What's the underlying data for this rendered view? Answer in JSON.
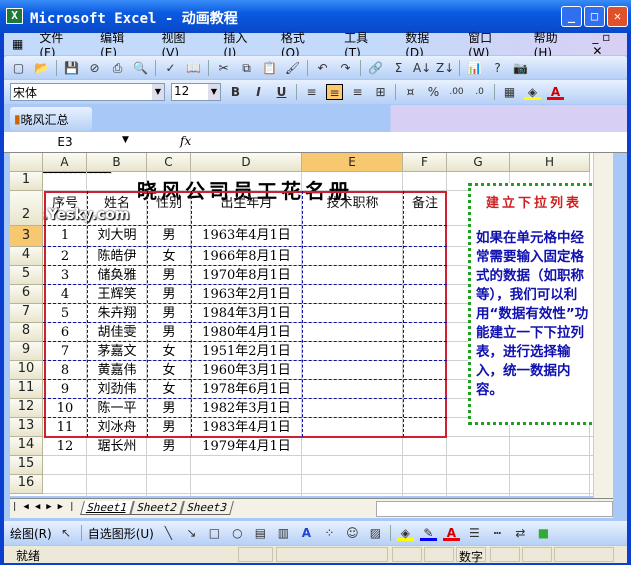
{
  "window": {
    "title": "Microsoft Excel - 动画教程",
    "minimize": "_",
    "maximize": "□",
    "close": "✕"
  },
  "menu": [
    "文件(F)",
    "编辑(E)",
    "视图(V)",
    "插入(I)",
    "格式(O)",
    "工具(T)",
    "数据(D)",
    "窗口(W)",
    "帮助(H)"
  ],
  "std_toolbar": [
    "new-icon",
    "open-icon",
    "save-icon",
    "permission-icon",
    "print-icon",
    "print-preview-icon",
    "spelling-icon",
    "research-icon",
    "cut-icon",
    "copy-icon",
    "paste-icon",
    "format-painter-icon",
    "undo-icon",
    "redo-icon",
    "hyperlink-icon",
    "autosum-icon",
    "sort-asc-icon",
    "sort-desc-icon",
    "chart-wizard-icon",
    "help-icon",
    "camera-icon"
  ],
  "fmt": {
    "font": "宋体",
    "size": "12",
    "bold": "B",
    "italic": "I",
    "underline": "U",
    "percent": "%"
  },
  "custom_toolbar": {
    "label": "晓风汇总"
  },
  "formula": {
    "name_box": "E3",
    "fx": "fx",
    "value": ""
  },
  "columns": [
    "A",
    "B",
    "C",
    "D",
    "E",
    "F",
    "G",
    "H"
  ],
  "rows": [
    "1",
    "2",
    "3",
    "4",
    "5",
    "6",
    "7",
    "8",
    "9",
    "10",
    "11",
    "12",
    "13",
    "14",
    "15",
    "16"
  ],
  "selected": {
    "column": "E",
    "row": "3"
  },
  "sheet_title": "晓风公司员工花名册",
  "headers": [
    "序号",
    "姓名",
    "性别",
    "出生年月",
    "技术职称",
    "备注"
  ],
  "records": [
    [
      "1",
      "刘大明",
      "男",
      "1963年4月1日"
    ],
    [
      "2",
      "陈皓伊",
      "女",
      "1966年8月1日"
    ],
    [
      "3",
      "储奂雅",
      "男",
      "1970年8月1日"
    ],
    [
      "4",
      "王辉笑",
      "男",
      "1963年2月1日"
    ],
    [
      "5",
      "朱卉翔",
      "男",
      "1984年3月1日"
    ],
    [
      "6",
      "胡佳雯",
      "男",
      "1980年4月1日"
    ],
    [
      "7",
      "茅嘉文",
      "女",
      "1951年2月1日"
    ],
    [
      "8",
      "黄嘉伟",
      "女",
      "1960年3月1日"
    ],
    [
      "9",
      "刘劲伟",
      "女",
      "1978年6月1日"
    ],
    [
      "10",
      "陈一平",
      "男",
      "1982年3月1日"
    ],
    [
      "11",
      "刘冰舟",
      "男",
      "1983年4月1日"
    ],
    [
      "12",
      "琚长州",
      "男",
      "1979年4月1日"
    ]
  ],
  "note": {
    "title": "建立下拉列表",
    "body": "如果在单元格中经常需要输入固定格式的数据（如职称等），我们可以利用“数据有效性”功能建立一下下拉列表，进行选择输入，统一数据内容。"
  },
  "watermark": "Soft.Yesky.com",
  "sheet_tabs": [
    "Sheet1",
    "Sheet2",
    "Sheet3"
  ],
  "draw_toolbar": {
    "draw": "绘图(R)",
    "autoshapes": "自选图形(U)"
  },
  "status": {
    "ready": "就绪",
    "num": "数字"
  },
  "colors": {
    "title_red": "#d02020",
    "note_blue": "#1010b0",
    "border_red": "#d02030",
    "grid_blue": "#1010a0"
  }
}
